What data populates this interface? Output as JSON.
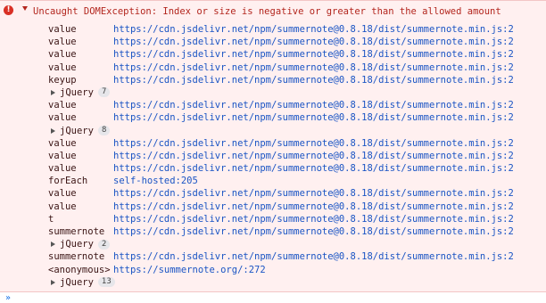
{
  "error": {
    "icon": "error-icon",
    "message": "Uncaught DOMException: Index or size is negative or greater than the allowed amount"
  },
  "rows": [
    {
      "type": "frame",
      "fn": "value",
      "loc": "https://cdn.jsdelivr.net/npm/summernote@0.8.18/dist/summernote.min.js:2"
    },
    {
      "type": "frame",
      "fn": "value",
      "loc": "https://cdn.jsdelivr.net/npm/summernote@0.8.18/dist/summernote.min.js:2"
    },
    {
      "type": "frame",
      "fn": "value",
      "loc": "https://cdn.jsdelivr.net/npm/summernote@0.8.18/dist/summernote.min.js:2"
    },
    {
      "type": "frame",
      "fn": "value",
      "loc": "https://cdn.jsdelivr.net/npm/summernote@0.8.18/dist/summernote.min.js:2"
    },
    {
      "type": "frame",
      "fn": "keyup",
      "loc": "https://cdn.jsdelivr.net/npm/summernote@0.8.18/dist/summernote.min.js:2"
    },
    {
      "type": "group",
      "label": "jQuery",
      "count": "7"
    },
    {
      "type": "frame",
      "fn": "value",
      "loc": "https://cdn.jsdelivr.net/npm/summernote@0.8.18/dist/summernote.min.js:2"
    },
    {
      "type": "frame",
      "fn": "value",
      "loc": "https://cdn.jsdelivr.net/npm/summernote@0.8.18/dist/summernote.min.js:2"
    },
    {
      "type": "group",
      "label": "jQuery",
      "count": "8"
    },
    {
      "type": "frame",
      "fn": "value",
      "loc": "https://cdn.jsdelivr.net/npm/summernote@0.8.18/dist/summernote.min.js:2"
    },
    {
      "type": "frame",
      "fn": "value",
      "loc": "https://cdn.jsdelivr.net/npm/summernote@0.8.18/dist/summernote.min.js:2"
    },
    {
      "type": "frame",
      "fn": "value",
      "loc": "https://cdn.jsdelivr.net/npm/summernote@0.8.18/dist/summernote.min.js:2"
    },
    {
      "type": "frame",
      "fn": "forEach",
      "loc": "self-hosted:205"
    },
    {
      "type": "frame",
      "fn": "value",
      "loc": "https://cdn.jsdelivr.net/npm/summernote@0.8.18/dist/summernote.min.js:2"
    },
    {
      "type": "frame",
      "fn": "value",
      "loc": "https://cdn.jsdelivr.net/npm/summernote@0.8.18/dist/summernote.min.js:2"
    },
    {
      "type": "frame",
      "fn": "t",
      "loc": "https://cdn.jsdelivr.net/npm/summernote@0.8.18/dist/summernote.min.js:2"
    },
    {
      "type": "frame",
      "fn": "summernote",
      "loc": "https://cdn.jsdelivr.net/npm/summernote@0.8.18/dist/summernote.min.js:2"
    },
    {
      "type": "group",
      "label": "jQuery",
      "count": "2"
    },
    {
      "type": "frame",
      "fn": "summernote",
      "loc": "https://cdn.jsdelivr.net/npm/summernote@0.8.18/dist/summernote.min.js:2"
    },
    {
      "type": "frame",
      "fn": "<anonymous>",
      "loc": "https://summernote.org/:272"
    },
    {
      "type": "group",
      "label": "jQuery",
      "count": "13"
    }
  ],
  "console_prompt": "»"
}
